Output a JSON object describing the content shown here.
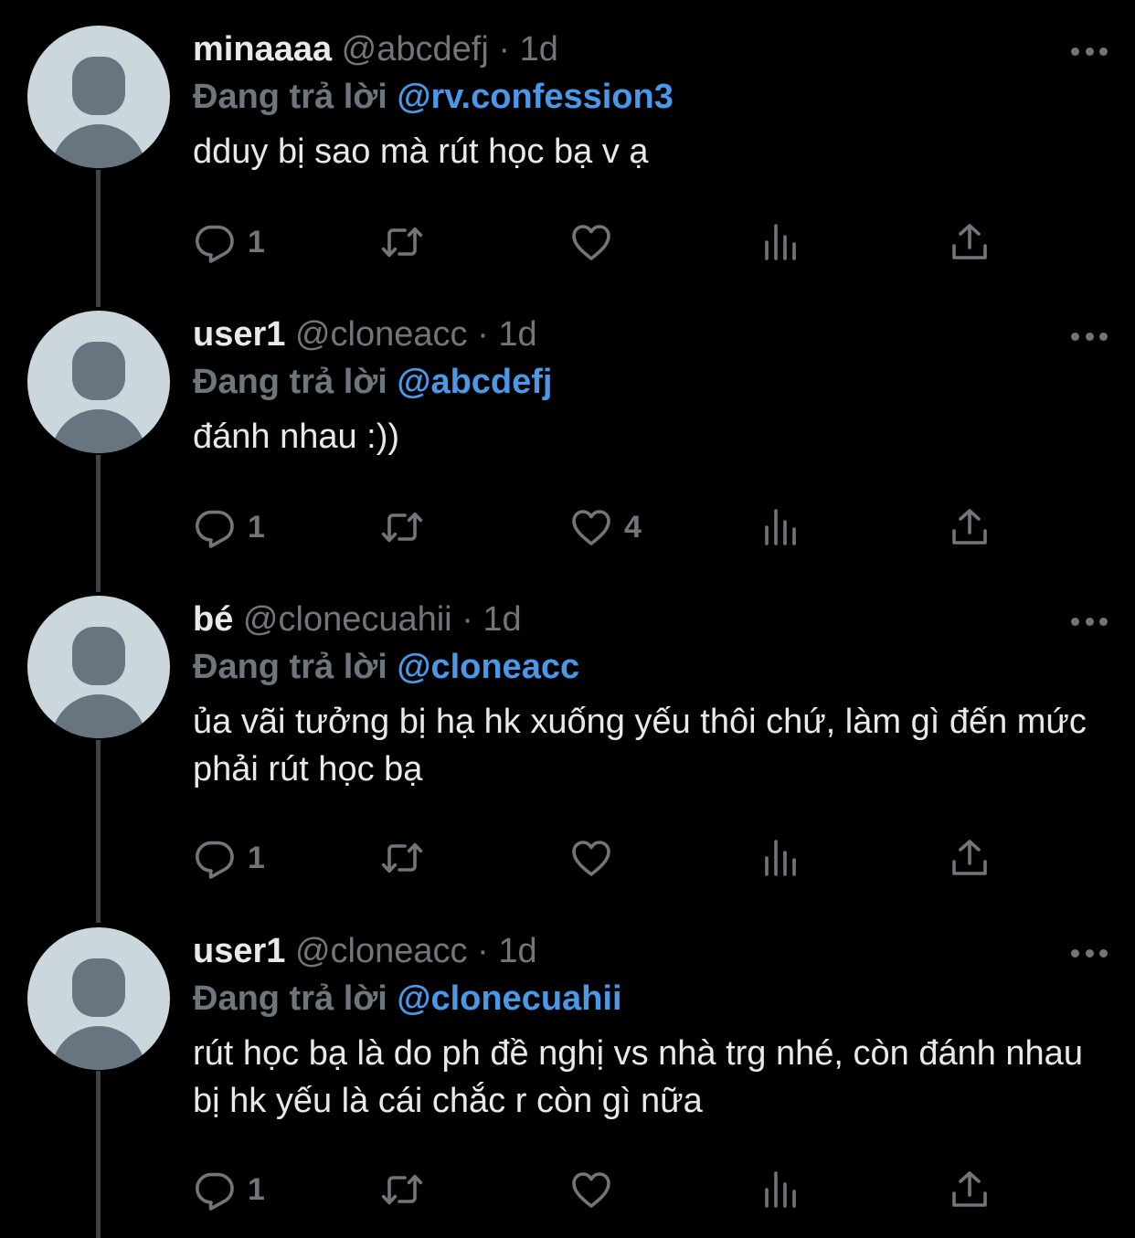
{
  "colors": {
    "background": "#000000",
    "text": "#e7e9ea",
    "muted": "#71767b",
    "mention": "#4a99e9",
    "avatar_bg": "#ccd6dd",
    "avatar_fg": "#66757f"
  },
  "reply_prefix": "Đang trả lời",
  "tweets": [
    {
      "name": "minaaaa",
      "handle": "@abcdefj",
      "separator": "·",
      "time": "1d",
      "replying_to": "@rv.confession3",
      "text": "dduy bị sao mà rút học bạ v ạ",
      "reply_count": "1",
      "retweet_count": "",
      "like_count": "",
      "icons": [
        "reply-icon",
        "retweet-icon",
        "like-icon",
        "analytics-icon",
        "share-icon"
      ]
    },
    {
      "name": "user1",
      "handle": "@cloneacc",
      "separator": "·",
      "time": "1d",
      "replying_to": "@abcdefj",
      "text": "đánh nhau :))",
      "reply_count": "1",
      "retweet_count": "",
      "like_count": "4",
      "icons": [
        "reply-icon",
        "retweet-icon",
        "like-icon",
        "analytics-icon",
        "share-icon"
      ]
    },
    {
      "name": "bé",
      "handle": "@clonecuahii",
      "separator": "·",
      "time": "1d",
      "replying_to": "@cloneacc",
      "text": "ủa vãi tưởng bị hạ hk xuống yếu thôi chứ, làm gì đến mức phải rút học bạ",
      "reply_count": "1",
      "retweet_count": "",
      "like_count": "",
      "icons": [
        "reply-icon",
        "retweet-icon",
        "like-icon",
        "analytics-icon",
        "share-icon"
      ]
    },
    {
      "name": "user1",
      "handle": "@cloneacc",
      "separator": "·",
      "time": "1d",
      "replying_to": "@clonecuahii",
      "text": "rút học bạ là do ph đề nghị vs nhà trg nhé, còn đánh nhau bị hk yếu là cái chắc r còn gì nữa",
      "reply_count": "1",
      "retweet_count": "",
      "like_count": "",
      "icons": [
        "reply-icon",
        "retweet-icon",
        "like-icon",
        "analytics-icon",
        "share-icon"
      ]
    }
  ]
}
